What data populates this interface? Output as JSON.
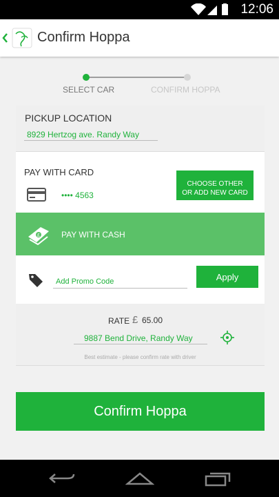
{
  "status_bar": {
    "time": "12:06",
    "icons": [
      "wifi-icon",
      "signal-icon",
      "battery-icon"
    ]
  },
  "app_bar": {
    "title": "Confirm Hoppa",
    "back_icon": "chevron-left-icon",
    "logo_icon": "hoppa-logo-icon"
  },
  "stepper": {
    "steps": [
      {
        "label": "SELECT CAR",
        "active": true
      },
      {
        "label": "CONFIRM HOPPA",
        "active": false
      }
    ]
  },
  "pickup": {
    "heading": "PICKUP LOCATION",
    "address": "8929 Hertzog ave. Randy Way"
  },
  "pay_card": {
    "heading": "PAY WITH CARD",
    "card_number": "•••• 4563",
    "button_line1": "CHOOSE OTHER",
    "button_line2": "OR ADD NEW CARD",
    "card_icon": "credit-card-icon"
  },
  "pay_cash": {
    "label": "PAY WITH CASH",
    "icon": "cash-icon"
  },
  "promo": {
    "placeholder": "Add Promo Code",
    "apply_label": "Apply",
    "icon": "tag-icon"
  },
  "rate": {
    "label": "RATE",
    "currency": "£",
    "value": "65.00",
    "destination": "9887 Bend Drive, Randy Way",
    "note": "Best estimate - please confirm rate with driver",
    "locate_icon": "crosshair-icon"
  },
  "confirm_button": "Confirm Hoppa",
  "nav_bar": {
    "items": [
      "back-icon",
      "home-icon",
      "recent-apps-icon"
    ]
  },
  "colors": {
    "accent": "#1fb23b",
    "cash_bg": "#5bc168",
    "step_inactive": "#c6c6c6"
  }
}
